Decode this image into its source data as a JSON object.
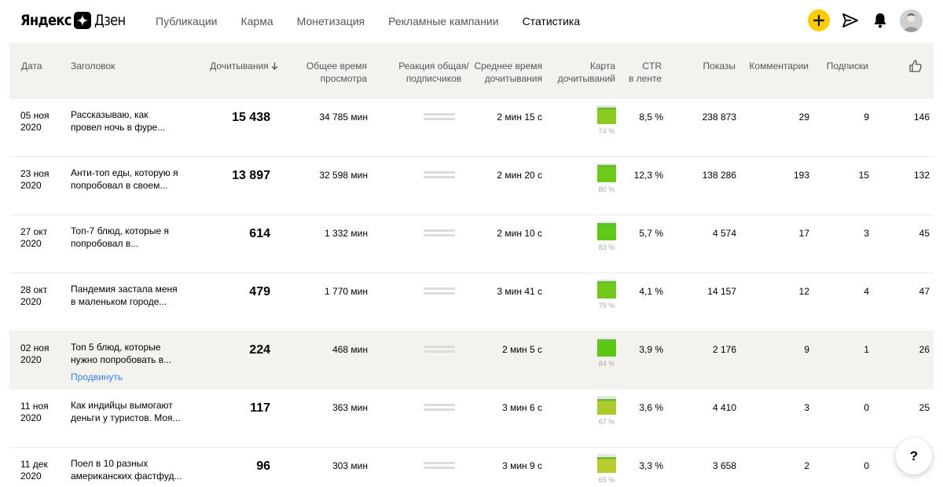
{
  "brand": {
    "left": "Яндекс",
    "right": "Дзен"
  },
  "nav": [
    {
      "label": "Публикации",
      "active": false
    },
    {
      "label": "Карма",
      "active": false
    },
    {
      "label": "Монетизация",
      "active": false
    },
    {
      "label": "Рекламные кампании",
      "active": false
    },
    {
      "label": "Статистика",
      "active": true
    }
  ],
  "header_icons": [
    "plus-icon",
    "send-icon",
    "bell-icon",
    "avatar"
  ],
  "accent_color": "#ffcc00",
  "table": {
    "columns": {
      "date": "Дата",
      "title": "Заголовок",
      "reads": "Дочитывания",
      "total_time_1": "Общее время",
      "total_time_2": "просмотра",
      "reaction_1": "Реакция общая/",
      "reaction_2": "подписчиков",
      "avg_time_1": "Среднее время",
      "avg_time_2": "дочитывания",
      "map_1": "Карта",
      "map_2": "дочитываний",
      "ctr_1": "CTR",
      "ctr_2": "в ленте",
      "shows": "Показы",
      "comments": "Комментарии",
      "subs": "Подписки",
      "likes_icon": "thumbs-up-icon"
    },
    "sort": {
      "column": "reads",
      "direction": "desc"
    },
    "rows": [
      {
        "date1": "05 ноя",
        "date2": "2020",
        "title1": "Рассказываю, как",
        "title2": "провел ночь в фуре...",
        "reads": "15 438",
        "total_time": "34 785 мин",
        "avg_time": "2 мин 15 с",
        "map_pct": "74 %",
        "map_value": 0.74,
        "ctr": "8,5 %",
        "shows": "238 873",
        "comments": "29",
        "subs": "9",
        "likes": "146",
        "highlight": false,
        "promote": ""
      },
      {
        "date1": "23 ноя",
        "date2": "2020",
        "title1": "Анти-топ еды, которую я",
        "title2": "попробовал в своем...",
        "reads": "13 897",
        "total_time": "32 598 мин",
        "avg_time": "2 мин 20 с",
        "map_pct": "80 %",
        "map_value": 0.8,
        "ctr": "12,3 %",
        "shows": "138 286",
        "comments": "193",
        "subs": "15",
        "likes": "132",
        "highlight": false,
        "promote": ""
      },
      {
        "date1": "27 окт",
        "date2": "2020",
        "title1": "Топ-7 блюд, которые я",
        "title2": "попробовал в...",
        "reads": "614",
        "total_time": "1 332 мин",
        "avg_time": "2 мин 10 с",
        "map_pct": "83 %",
        "map_value": 0.83,
        "ctr": "5,7 %",
        "shows": "4 574",
        "comments": "17",
        "subs": "3",
        "likes": "45",
        "highlight": false,
        "promote": ""
      },
      {
        "date1": "28 окт",
        "date2": "2020",
        "title1": "Пандемия застала меня",
        "title2": "в маленьком городе...",
        "reads": "479",
        "total_time": "1 770 мин",
        "avg_time": "3 мин 41 с",
        "map_pct": "79 %",
        "map_value": 0.79,
        "ctr": "4,1 %",
        "shows": "14 157",
        "comments": "12",
        "subs": "4",
        "likes": "47",
        "highlight": false,
        "promote": ""
      },
      {
        "date1": "02 ноя",
        "date2": "2020",
        "title1": "Топ 5 блюд, которые",
        "title2": "нужно попробовать в...",
        "reads": "224",
        "total_time": "468 мин",
        "avg_time": "2 мин 5 с",
        "map_pct": "84 %",
        "map_value": 0.84,
        "ctr": "3,9 %",
        "shows": "2 176",
        "comments": "9",
        "subs": "1",
        "likes": "26",
        "highlight": true,
        "promote": "Продвинуть"
      },
      {
        "date1": "11 ноя",
        "date2": "2020",
        "title1": "Как индийцы вымогают",
        "title2": "деньги у туристов. Моя...",
        "reads": "117",
        "total_time": "363 мин",
        "avg_time": "3 мин 6 с",
        "map_pct": "67 %",
        "map_value": 0.67,
        "ctr": "3,6 %",
        "shows": "4 410",
        "comments": "3",
        "subs": "0",
        "likes": "25",
        "highlight": false,
        "promote": ""
      },
      {
        "date1": "11 дек",
        "date2": "2020",
        "title1": "Поел в 10 разных",
        "title2": "американских фастфуд...",
        "reads": "96",
        "total_time": "303 мин",
        "avg_time": "3 мин 9 с",
        "map_pct": "65 %",
        "map_value": 0.65,
        "ctr": "3,3 %",
        "shows": "3 658",
        "comments": "2",
        "subs": "0",
        "likes": "",
        "highlight": false,
        "promote": ""
      }
    ]
  },
  "help_button": "?"
}
